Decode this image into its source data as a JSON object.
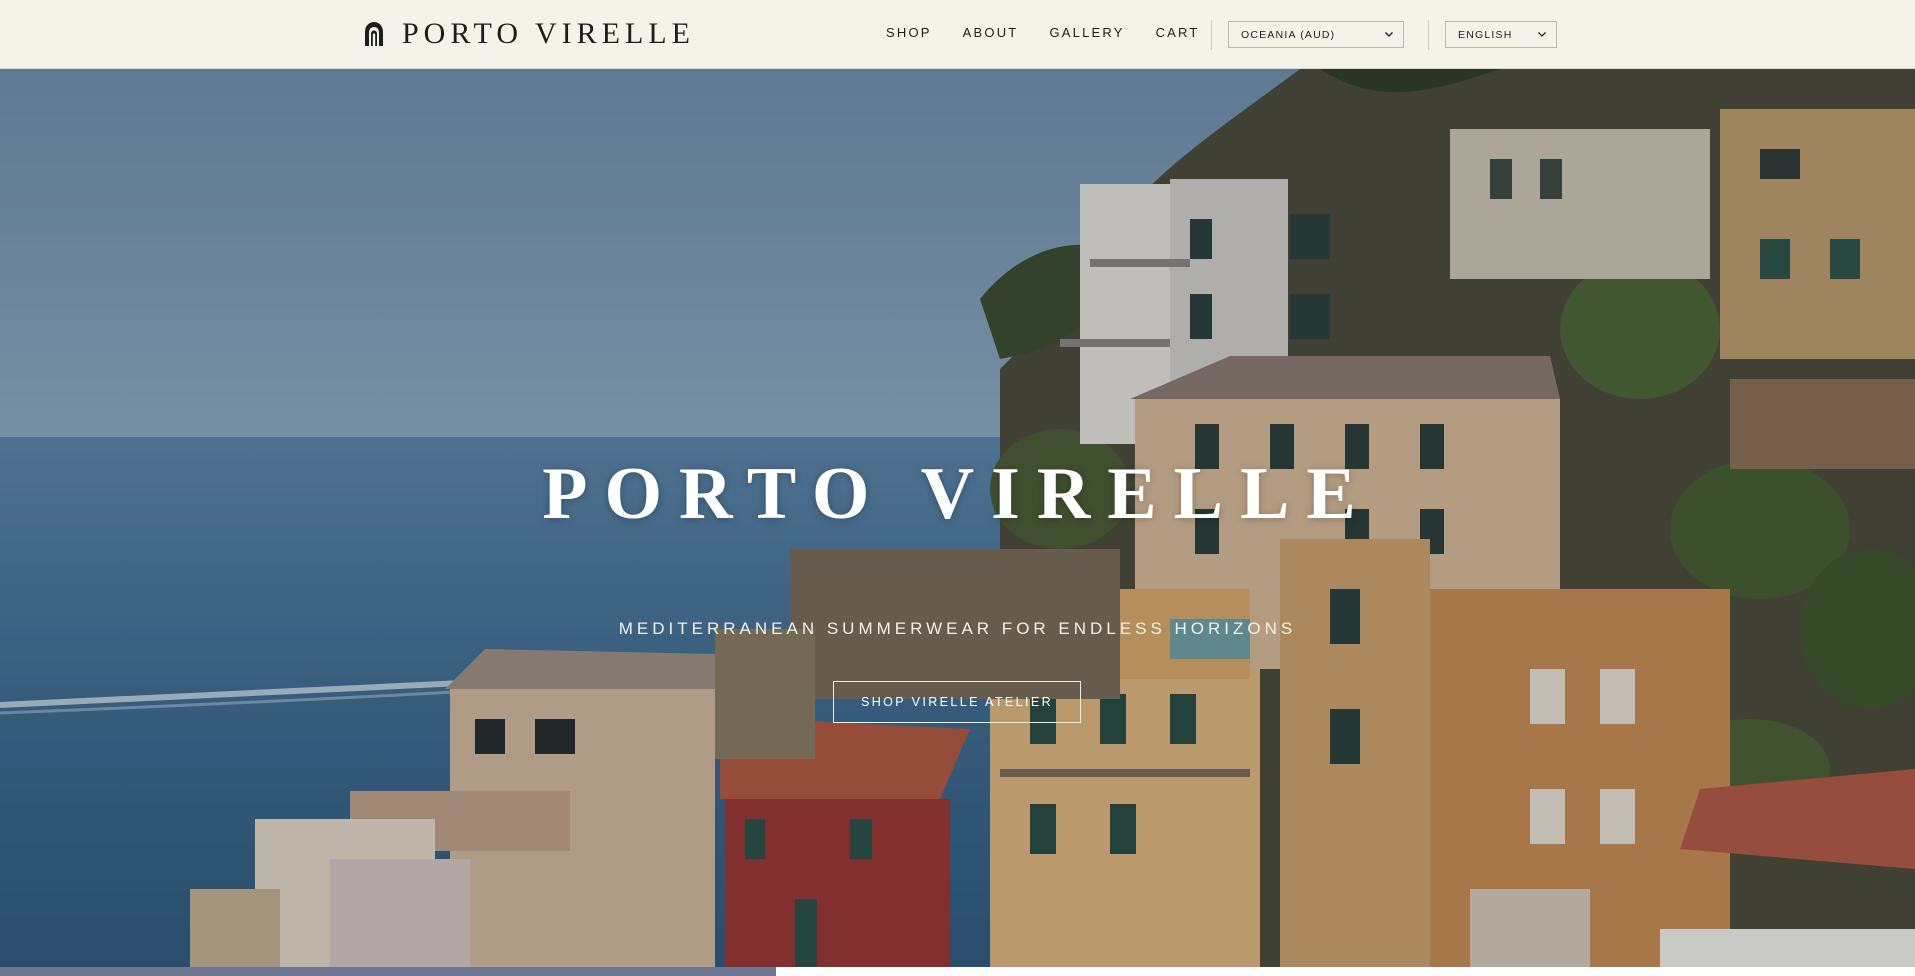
{
  "header": {
    "brand_name": "PORTO VIRELLE",
    "brand_icon": "arch-logo-icon",
    "nav": [
      "SHOP",
      "ABOUT",
      "GALLERY",
      "CART"
    ],
    "region_select": {
      "value": "OCEANIA (AUD)",
      "icon": "chevron-down-icon"
    },
    "language_select": {
      "value": "ENGLISH",
      "icon": "chevron-down-icon"
    }
  },
  "hero": {
    "title": "PORTO VIRELLE",
    "tagline": "MEDITERRANEAN SUMMERWEAR FOR ENDLESS HORIZONS",
    "cta_label": "SHOP VIRELLE ATELIER"
  },
  "slideshow": {
    "progress": 0.405
  },
  "colors": {
    "header_bg": "#f5f3e9",
    "text": "#1d1d1b",
    "sea": "#3f6a8e",
    "sky": "#7c9ab2",
    "progress": "#6d7590"
  }
}
